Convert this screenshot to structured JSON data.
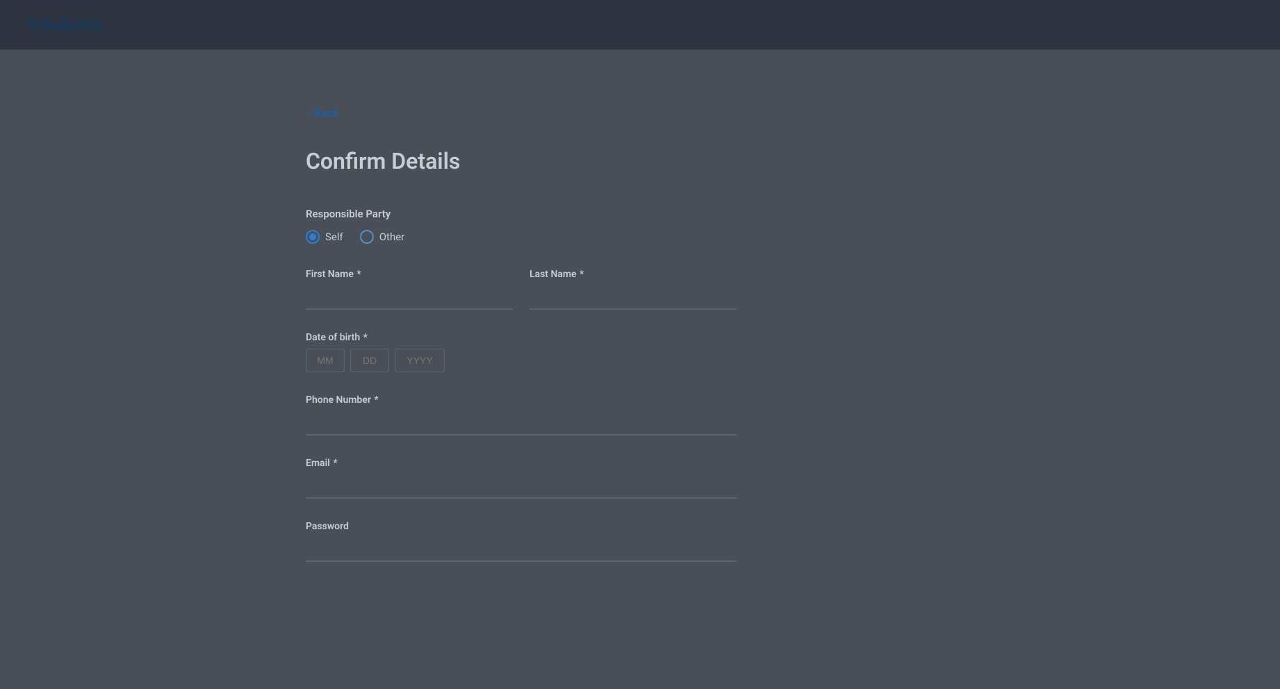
{
  "header": {
    "logo_text": "teledentix"
  },
  "nav": {
    "back_label": "Back"
  },
  "form": {
    "title": "Confirm Details",
    "responsible_party": {
      "label": "Responsible Party",
      "options": [
        {
          "value": "self",
          "label": "Self",
          "checked": true
        },
        {
          "value": "other",
          "label": "Other",
          "checked": false
        }
      ]
    },
    "first_name": {
      "label": "First Name",
      "required": true,
      "placeholder": ""
    },
    "last_name": {
      "label": "Last Name",
      "required": true,
      "placeholder": ""
    },
    "dob": {
      "label": "Date of birth",
      "required": true,
      "mm_placeholder": "MM",
      "dd_placeholder": "DD",
      "yyyy_placeholder": "YYYY"
    },
    "phone": {
      "label": "Phone Number",
      "required": true,
      "placeholder": ""
    },
    "email": {
      "label": "Email",
      "required": true,
      "placeholder": ""
    },
    "password": {
      "label": "Password",
      "required": false,
      "placeholder": ""
    }
  }
}
